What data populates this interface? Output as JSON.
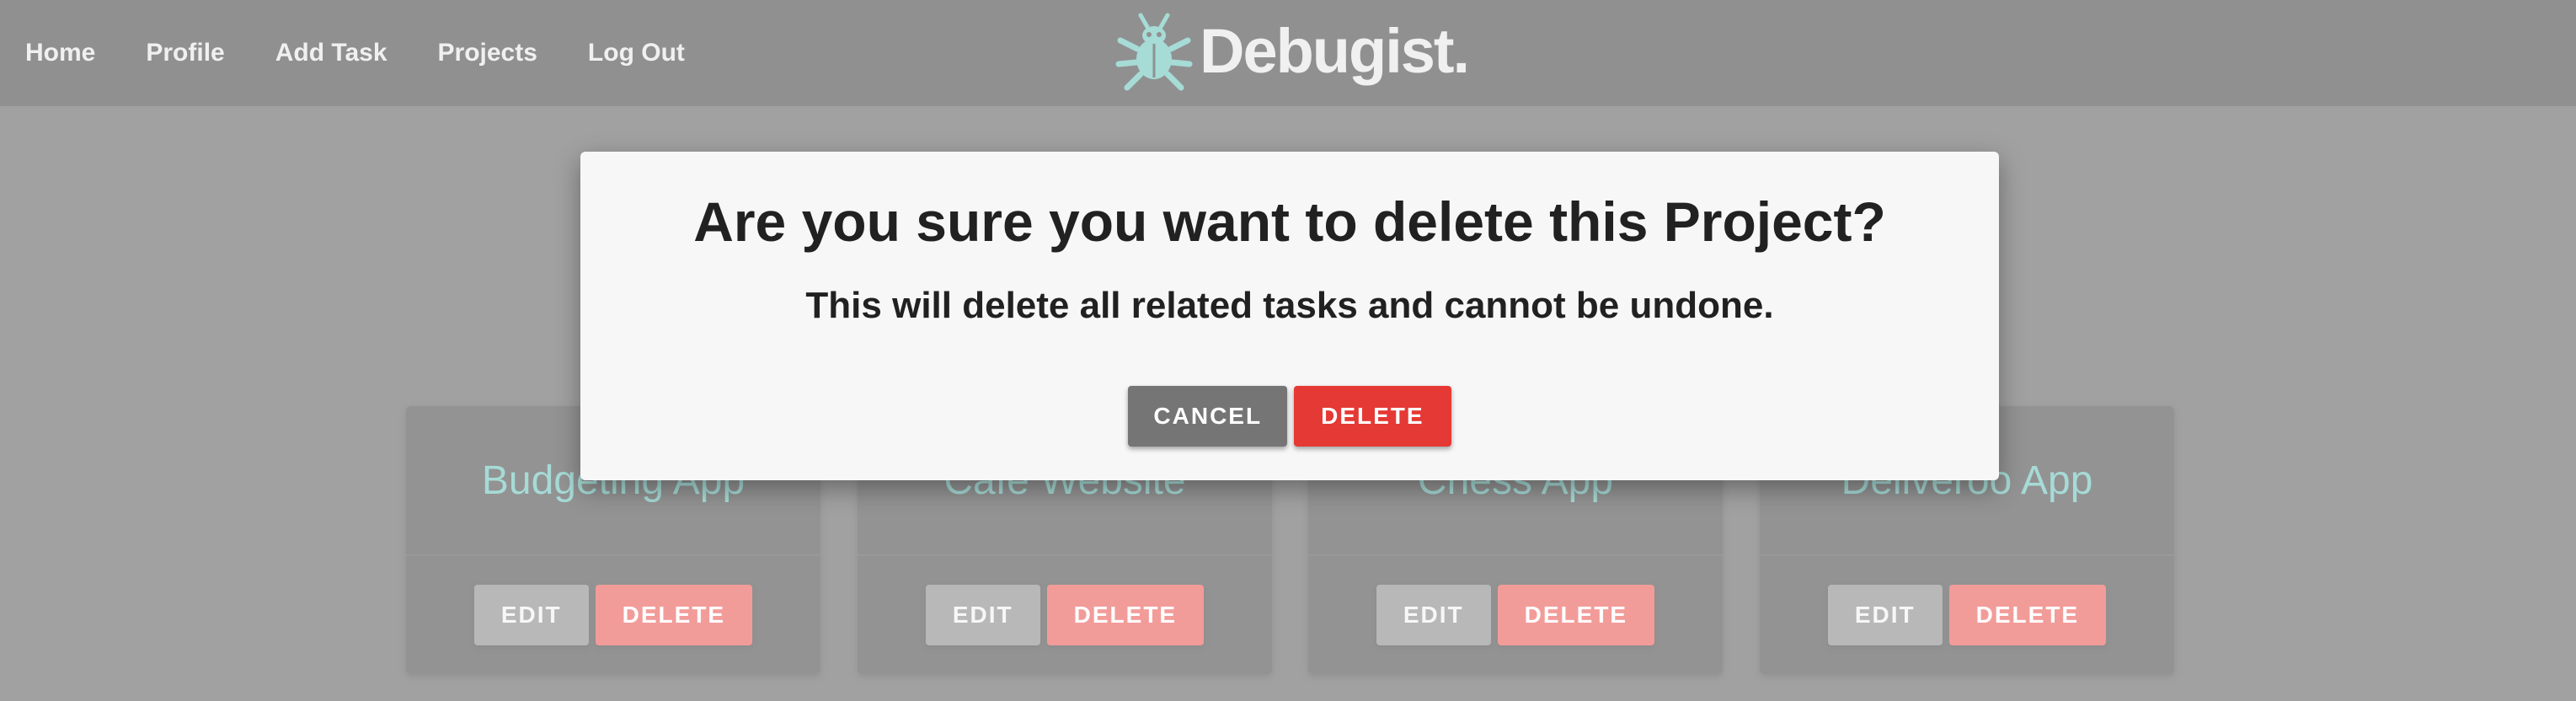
{
  "nav": {
    "links": [
      "Home",
      "Profile",
      "Add Task",
      "Projects",
      "Log Out"
    ]
  },
  "brand": {
    "name": "Debugist.",
    "logo_icon": "bug-icon",
    "logo_color": "#4db6ac"
  },
  "projects": [
    {
      "title": "Budgeting App",
      "edit_label": "EDIT",
      "delete_label": "DELETE"
    },
    {
      "title": "Cafe Website",
      "edit_label": "EDIT",
      "delete_label": "DELETE"
    },
    {
      "title": "Chess App",
      "edit_label": "EDIT",
      "delete_label": "DELETE"
    },
    {
      "title": "Deliveroo App",
      "edit_label": "EDIT",
      "delete_label": "DELETE"
    }
  ],
  "modal": {
    "title": "Are you sure you want to delete this Project?",
    "subtitle": "This will delete all related tasks and cannot be undone.",
    "cancel_label": "CANCEL",
    "delete_label": "DELETE"
  },
  "colors": {
    "accent": "#4db6ac",
    "danger": "#e53935",
    "navbar": "#212121",
    "card": "#262626"
  }
}
